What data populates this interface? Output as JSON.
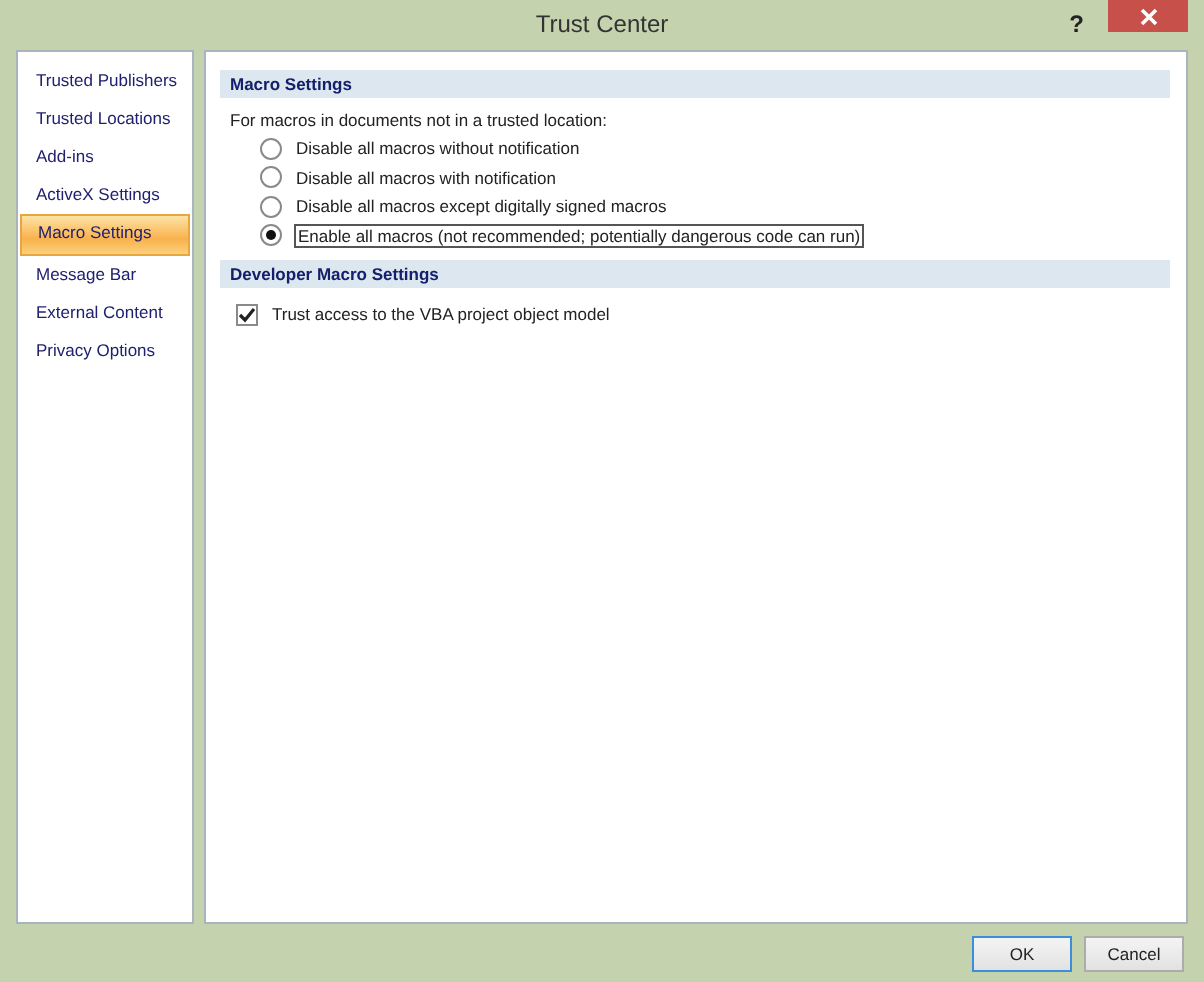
{
  "window": {
    "title": "Trust Center",
    "help": "?"
  },
  "sidebar": {
    "items": [
      {
        "label": "Trusted Publishers",
        "selected": false
      },
      {
        "label": "Trusted Locations",
        "selected": false
      },
      {
        "label": "Add-ins",
        "selected": false
      },
      {
        "label": "ActiveX Settings",
        "selected": false
      },
      {
        "label": "Macro Settings",
        "selected": true
      },
      {
        "label": "Message Bar",
        "selected": false
      },
      {
        "label": "External Content",
        "selected": false
      },
      {
        "label": "Privacy Options",
        "selected": false
      }
    ]
  },
  "sections": [
    {
      "title": "Macro Settings",
      "intro": "For macros in documents not in a trusted location:",
      "options": [
        {
          "kind": "radio",
          "label": "Disable all macros without notification",
          "selected": false
        },
        {
          "kind": "radio",
          "label": "Disable all macros with notification",
          "selected": false
        },
        {
          "kind": "radio",
          "label": "Disable all macros except digitally signed macros",
          "selected": false
        },
        {
          "kind": "radio",
          "label": "Enable all macros (not recommended; potentially dangerous code can run)",
          "selected": true
        }
      ]
    },
    {
      "title": "Developer Macro Settings",
      "options": [
        {
          "kind": "checkbox",
          "label": "Trust access to the VBA project object model",
          "checked": true
        }
      ]
    }
  ],
  "buttons": [
    "OK",
    "Cancel"
  ]
}
